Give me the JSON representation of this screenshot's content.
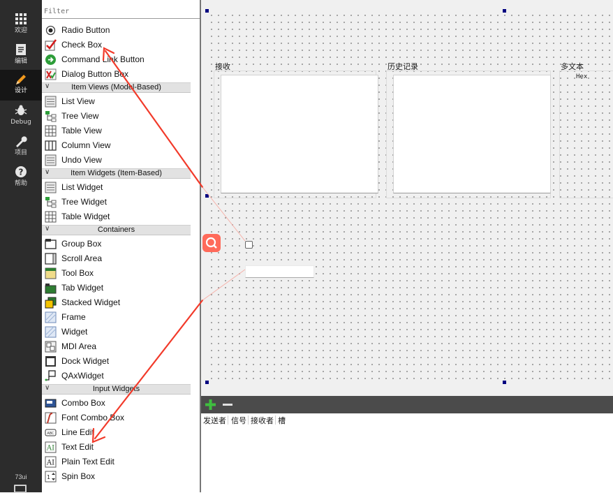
{
  "mode_bar": {
    "items": [
      {
        "label": "欢迎",
        "icon": "grid-icon"
      },
      {
        "label": "编辑",
        "icon": "edit-doc-icon"
      },
      {
        "label": "设计",
        "icon": "pencil-icon",
        "active": true
      },
      {
        "label": "Debug",
        "icon": "bug-icon"
      },
      {
        "label": "项目",
        "icon": "wrench-icon"
      },
      {
        "label": "帮助",
        "icon": "help-icon"
      }
    ],
    "kit_label": "73ui"
  },
  "widget_box": {
    "filter_placeholder": "Filter",
    "items": [
      {
        "kind": "item",
        "label": "Radio Button",
        "icon": "radio-button-icon"
      },
      {
        "kind": "item",
        "label": "Check Box",
        "icon": "check-box-icon"
      },
      {
        "kind": "item",
        "label": "Command Link Button",
        "icon": "command-link-icon"
      },
      {
        "kind": "item",
        "label": "Dialog Button Box",
        "icon": "dialog-button-box-icon"
      },
      {
        "kind": "category",
        "label": "Item Views (Model-Based)"
      },
      {
        "kind": "item",
        "label": "List View",
        "icon": "list-view-icon"
      },
      {
        "kind": "item",
        "label": "Tree View",
        "icon": "tree-view-icon"
      },
      {
        "kind": "item",
        "label": "Table View",
        "icon": "table-view-icon"
      },
      {
        "kind": "item",
        "label": "Column View",
        "icon": "column-view-icon"
      },
      {
        "kind": "item",
        "label": "Undo View",
        "icon": "undo-view-icon"
      },
      {
        "kind": "category",
        "label": "Item Widgets (Item-Based)"
      },
      {
        "kind": "item",
        "label": "List Widget",
        "icon": "list-widget-icon"
      },
      {
        "kind": "item",
        "label": "Tree Widget",
        "icon": "tree-widget-icon"
      },
      {
        "kind": "item",
        "label": "Table Widget",
        "icon": "table-widget-icon"
      },
      {
        "kind": "category",
        "label": "Containers"
      },
      {
        "kind": "item",
        "label": "Group Box",
        "icon": "group-box-icon"
      },
      {
        "kind": "item",
        "label": "Scroll Area",
        "icon": "scroll-area-icon"
      },
      {
        "kind": "item",
        "label": "Tool Box",
        "icon": "tool-box-icon"
      },
      {
        "kind": "item",
        "label": "Tab Widget",
        "icon": "tab-widget-icon"
      },
      {
        "kind": "item",
        "label": "Stacked Widget",
        "icon": "stacked-widget-icon"
      },
      {
        "kind": "item",
        "label": "Frame",
        "icon": "frame-icon"
      },
      {
        "kind": "item",
        "label": "Widget",
        "icon": "widget-icon"
      },
      {
        "kind": "item",
        "label": "MDI Area",
        "icon": "mdi-area-icon"
      },
      {
        "kind": "item",
        "label": "Dock Widget",
        "icon": "dock-widget-icon"
      },
      {
        "kind": "item",
        "label": "QAxWidget",
        "icon": "qaxwidget-icon"
      },
      {
        "kind": "category",
        "label": "Input Widgets"
      },
      {
        "kind": "item",
        "label": "Combo Box",
        "icon": "combo-box-icon"
      },
      {
        "kind": "item",
        "label": "Font Combo Box",
        "icon": "font-combo-box-icon"
      },
      {
        "kind": "item",
        "label": "Line Edit",
        "icon": "line-edit-icon"
      },
      {
        "kind": "item",
        "label": "Text Edit",
        "icon": "text-edit-icon"
      },
      {
        "kind": "item",
        "label": "Plain Text Edit",
        "icon": "plain-text-edit-icon"
      },
      {
        "kind": "item",
        "label": "Spin Box",
        "icon": "spin-box-icon"
      }
    ]
  },
  "canvas": {
    "groups": [
      {
        "title": "接收"
      },
      {
        "title": "历史记录"
      },
      {
        "title": "多文本",
        "sub_label": "Hex"
      }
    ]
  },
  "signal_slot": {
    "columns": [
      "发送者",
      "信号",
      "接收者",
      "槽"
    ]
  },
  "colors": {
    "annotation_arrow": "#f23a2a",
    "selection_handle": "#000080",
    "mode_bar": "#2c2c2c",
    "category_header": "#e2e2e2"
  }
}
